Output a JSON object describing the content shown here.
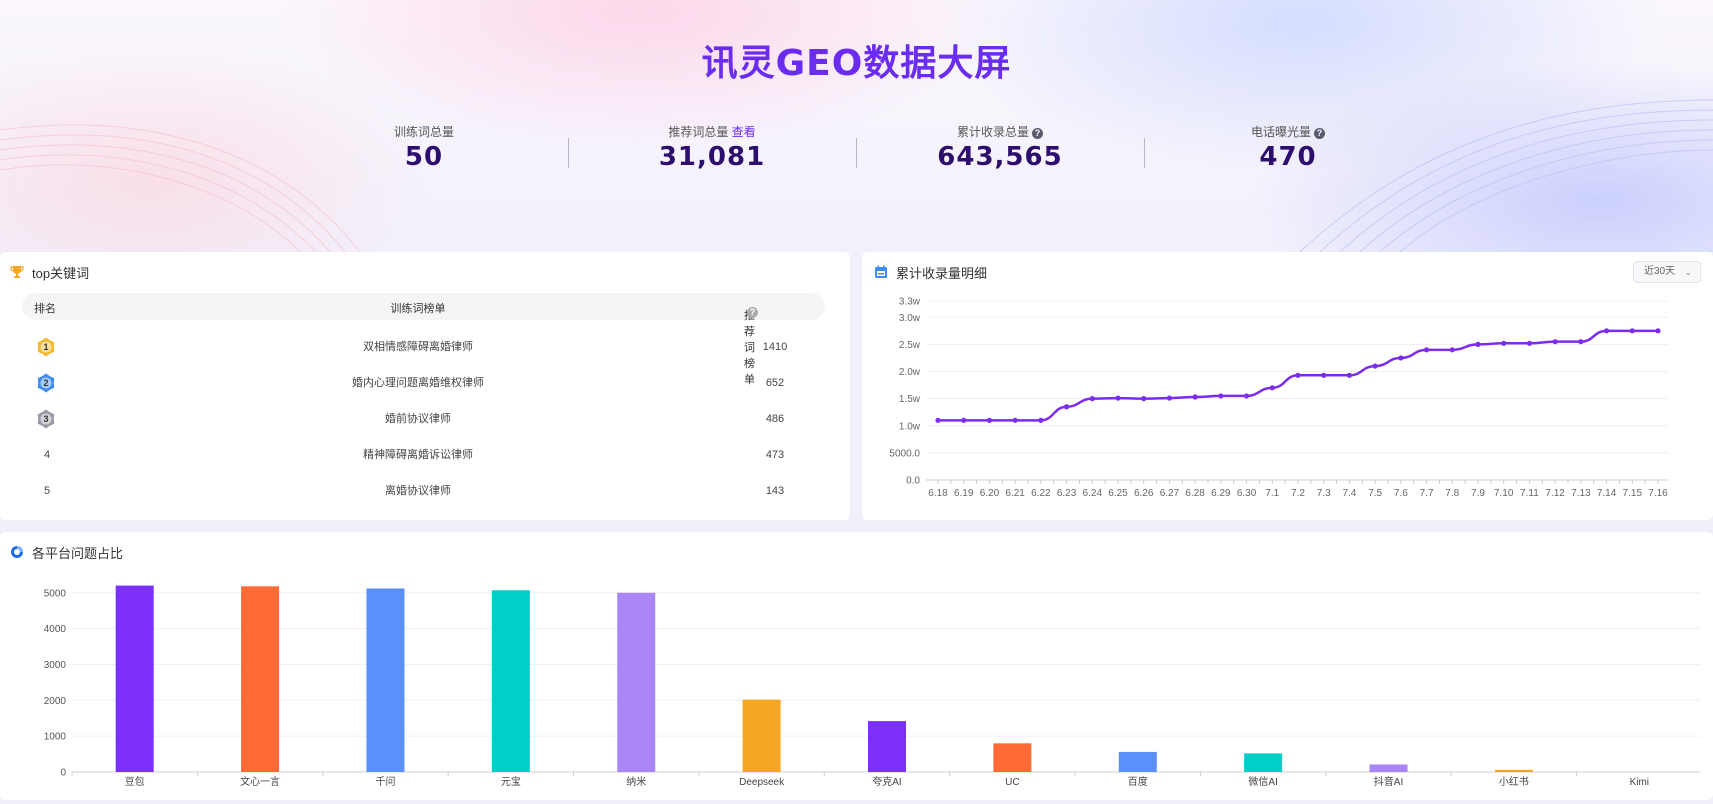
{
  "hero": {
    "title": "讯灵GEO数据大屏",
    "stats": [
      {
        "label": "训练词总量",
        "value": "50"
      },
      {
        "label": "推荐词总量",
        "link": "查看",
        "value": "31,081"
      },
      {
        "label": "累计收录总量",
        "value": "643,565",
        "help": "?"
      },
      {
        "label": "电话曝光量",
        "value": "470",
        "help": "?"
      }
    ]
  },
  "top_keywords": {
    "title": "top关键词",
    "columns": [
      "排名",
      "训练词榜单",
      "推荐词榜单"
    ],
    "help": "?",
    "rows": [
      {
        "rank": "1",
        "keyword": "双相情感障碍离婚律师",
        "count": "1410"
      },
      {
        "rank": "2",
        "keyword": "婚内心理问题离婚维权律师",
        "count": "652"
      },
      {
        "rank": "3",
        "keyword": "婚前协议律师",
        "count": "486"
      },
      {
        "rank": "4",
        "keyword": "精神障碍离婚诉讼律师",
        "count": "473"
      },
      {
        "rank": "5",
        "keyword": "离婚协议律师",
        "count": "143"
      }
    ],
    "medal_colors": [
      "#f5b82e",
      "#3d8cf0",
      "#9a9aa6"
    ]
  },
  "cumulative": {
    "title": "累计收录量明细",
    "range_select": "近30天",
    "chevron_icon": "chevron-down-icon"
  },
  "platforms": {
    "title": "各平台问题占比"
  },
  "chart_data": [
    {
      "type": "line",
      "title": "累计收录量明细",
      "x": [
        "6.18",
        "6.19",
        "6.20",
        "6.21",
        "6.22",
        "6.23",
        "6.24",
        "6.25",
        "6.26",
        "6.27",
        "6.28",
        "6.29",
        "6.30",
        "7.1",
        "7.2",
        "7.3",
        "7.4",
        "7.5",
        "7.6",
        "7.7",
        "7.8",
        "7.9",
        "7.10",
        "7.11",
        "7.12",
        "7.13",
        "7.14",
        "7.15",
        "7.16"
      ],
      "xticks_full": [
        "6.18",
        "",
        "6.19",
        "",
        "6.20",
        "",
        "6.21",
        "",
        "6.22",
        "",
        "6.23",
        "",
        "6.24",
        "",
        "6.25",
        "",
        "6.26",
        "",
        "6.27",
        "",
        "6.28",
        "",
        "6.29",
        "",
        "6.30",
        "",
        "7.1",
        "",
        "7.2",
        "",
        "7.3",
        "",
        "7.4",
        "",
        "7.5",
        "",
        "7.6",
        "",
        "7.7",
        "",
        "7.8",
        "",
        "7.9",
        "",
        "7.10",
        "",
        "7.11",
        "",
        "7.12",
        "",
        "7.13",
        "",
        "7.14",
        "",
        "7.15",
        "",
        "7.16"
      ],
      "values": [
        11000,
        11000,
        11000,
        11000,
        11000,
        13500,
        15000,
        15100,
        15000,
        15100,
        15300,
        15500,
        15500,
        17000,
        19300,
        19300,
        19300,
        21000,
        22500,
        24000,
        24000,
        25000,
        25200,
        25200,
        25500,
        25500,
        27500,
        27500,
        27500
      ],
      "ylim": [
        0,
        33000
      ],
      "yticks": [
        0,
        5000,
        10000,
        15000,
        20000,
        25000,
        30000,
        33000
      ],
      "ytick_labels": [
        "0.0",
        "5000.0",
        "1.0w",
        "1.5w",
        "2.0w",
        "2.5w",
        "3.0w",
        "3.3w"
      ],
      "color": "#7c2cf0",
      "grid": true
    },
    {
      "type": "bar",
      "title": "各平台问题占比",
      "categories": [
        "豆包",
        "文心一言",
        "千问",
        "元宝",
        "纳米",
        "Deepseek",
        "夸克AI",
        "UC",
        "百度",
        "微信AI",
        "抖音AI",
        "小红书",
        "Kimi"
      ],
      "values": [
        5200,
        5180,
        5120,
        5070,
        5000,
        2020,
        1420,
        800,
        560,
        520,
        210,
        60,
        0
      ],
      "colors": [
        "#7b2ff7",
        "#ff6b35",
        "#5b8ff9",
        "#00cfc8",
        "#a985f5",
        "#f5a623",
        "#7b2ff7",
        "#ff6b35",
        "#5b8ff9",
        "#00cfc8",
        "#a985f5",
        "#f5a623",
        "#7b2ff7"
      ],
      "ylim": [
        0,
        5300
      ],
      "yticks": [
        0,
        1000,
        2000,
        3000,
        4000,
        5000
      ],
      "grid": true
    }
  ]
}
